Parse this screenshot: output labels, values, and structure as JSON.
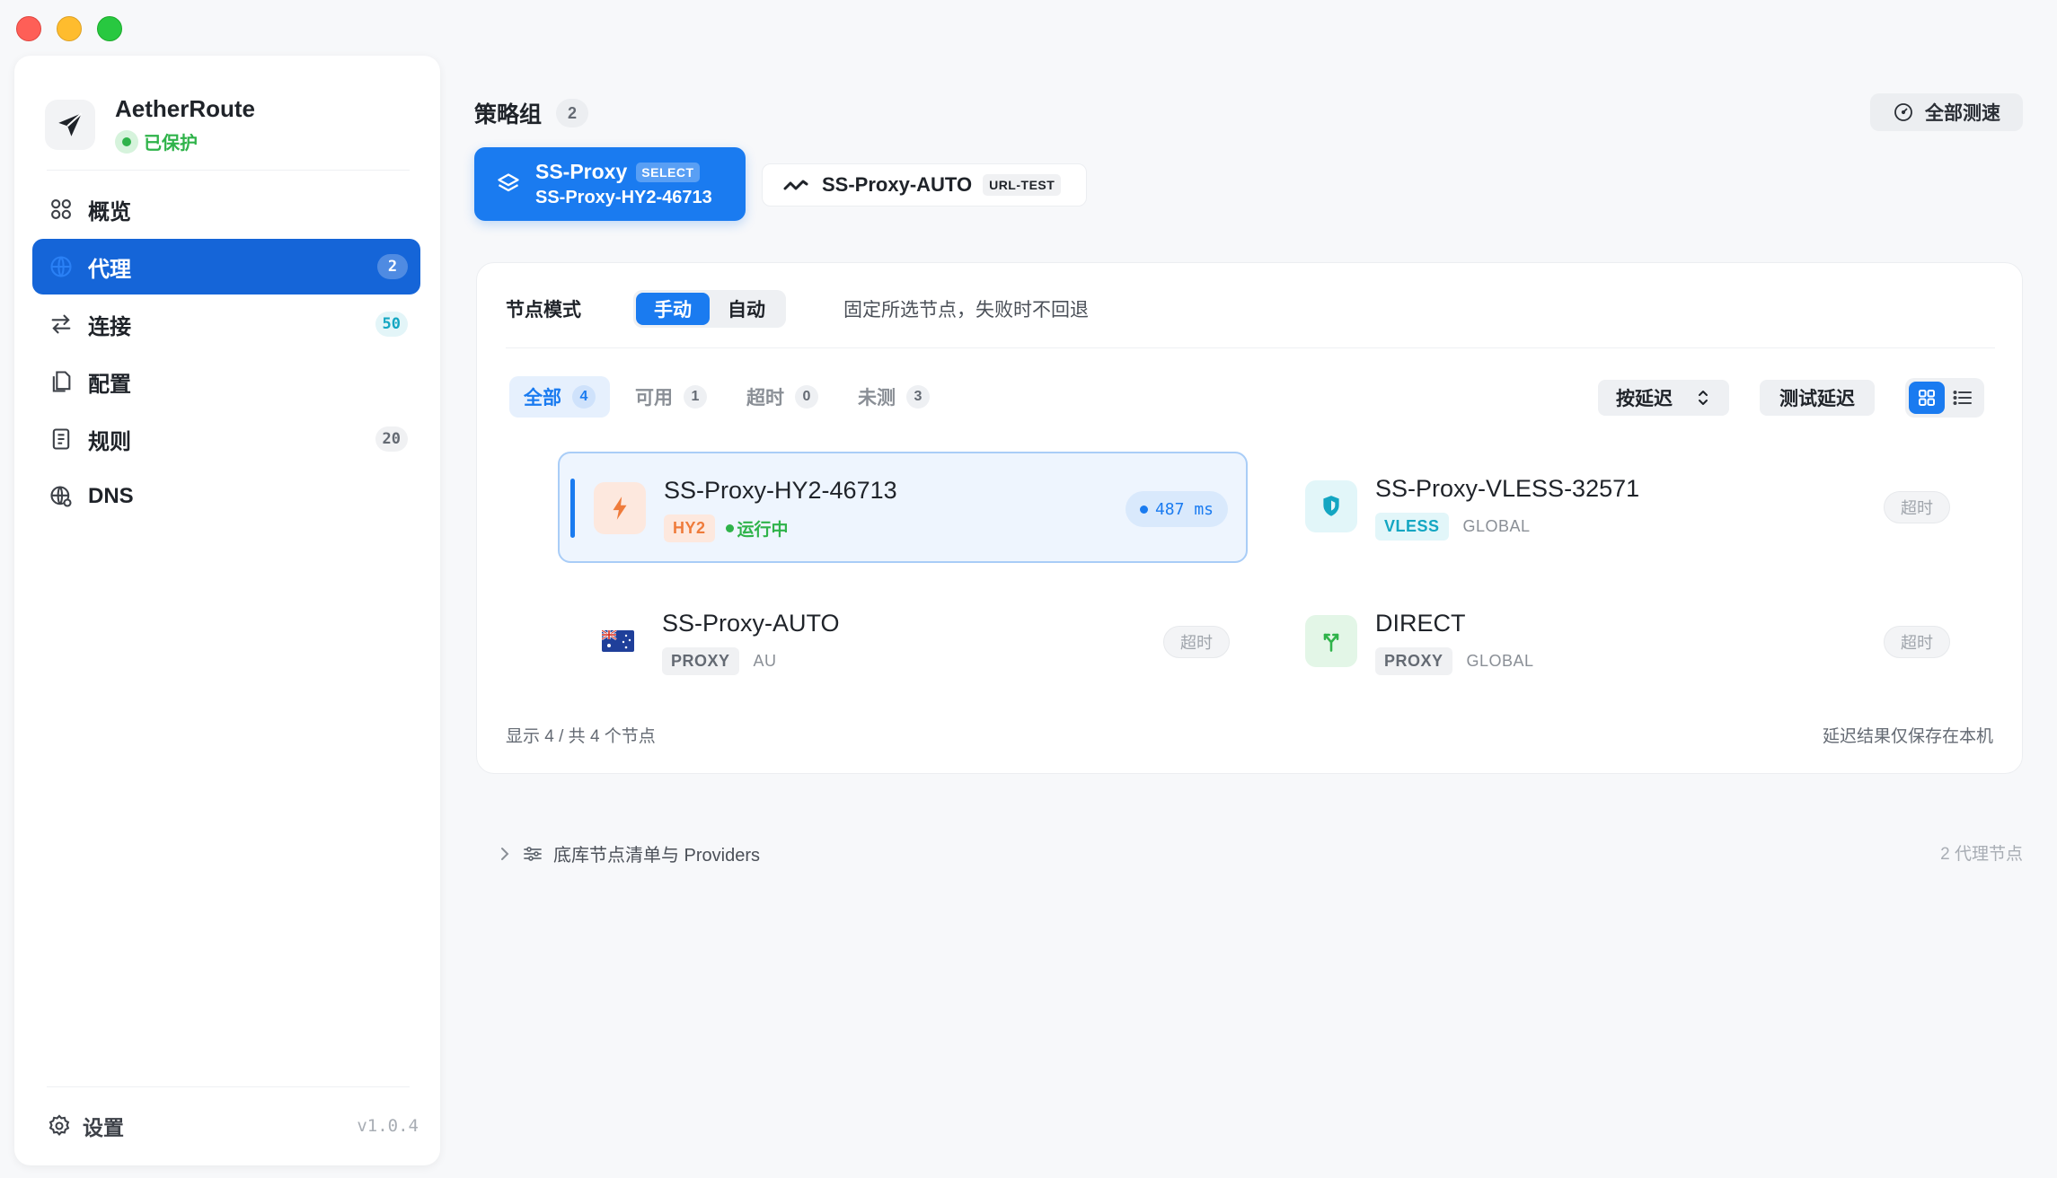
{
  "sidebar": {
    "brand": {
      "name": "AetherRoute",
      "status": "已保护"
    },
    "items": [
      {
        "label": "概览",
        "icon": "grid-circles-icon",
        "badge": null
      },
      {
        "label": "代理",
        "icon": "globe-icon",
        "badge": "2"
      },
      {
        "label": "连接",
        "icon": "arrows-left-right-icon",
        "badge": "50"
      },
      {
        "label": "配置",
        "icon": "documents-icon",
        "badge": null
      },
      {
        "label": "规则",
        "icon": "list-doc-icon",
        "badge": "20"
      },
      {
        "label": "DNS",
        "icon": "globe-network-icon",
        "badge": null
      }
    ],
    "active_index": 1,
    "settings_label": "设置",
    "version": "v1.0.4"
  },
  "header": {
    "title": "策略组",
    "group_count": "2",
    "test_all_label": "全部测速"
  },
  "groups": [
    {
      "name": "SS-Proxy",
      "type": "SELECT",
      "current": "SS-Proxy-HY2-46713",
      "selected": true
    },
    {
      "name": "SS-Proxy-AUTO",
      "type": "URL-TEST",
      "selected": false
    }
  ],
  "panel": {
    "mode_label": "节点模式",
    "modes": [
      "手动",
      "自动"
    ],
    "active_mode": "手动",
    "mode_desc": "固定所选节点，失败时不回退",
    "filters": [
      {
        "label": "全部",
        "count": "4",
        "active": true
      },
      {
        "label": "可用",
        "count": "1",
        "active": false
      },
      {
        "label": "超时",
        "count": "0",
        "active": false
      },
      {
        "label": "未测",
        "count": "3",
        "active": false
      }
    ],
    "sort_label": "按延迟",
    "test_delay_label": "测试延迟",
    "view_mode": "grid",
    "nodes": [
      {
        "name": "SS-Proxy-HY2-46713",
        "tag": "HY2",
        "status": "运行中",
        "latency": "487 ms",
        "selected": true,
        "icon": "bolt-icon"
      },
      {
        "name": "SS-Proxy-VLESS-32571",
        "tag": "VLESS",
        "sub": "GLOBAL",
        "result": "超时",
        "icon": "shield-icon"
      },
      {
        "name": "SS-Proxy-AUTO",
        "tag": "PROXY",
        "sub": "AU",
        "result": "超时",
        "icon": "australia-flag-icon"
      },
      {
        "name": "DIRECT",
        "tag": "PROXY",
        "sub": "GLOBAL",
        "result": "超时",
        "icon": "branch-icon"
      }
    ],
    "footer_left": "显示 4 / 共 4 个节点",
    "footer_right": "延迟结果仅保存在本机"
  },
  "providers": {
    "label": "底库节点清单与 Providers",
    "count": "2 代理节点"
  },
  "colors": {
    "accent": "#1a7bf0",
    "sidebar_active": "#1565d8",
    "success": "#2fb34a",
    "teal": "#14a6c2",
    "hy2": "#ef7b3b"
  }
}
